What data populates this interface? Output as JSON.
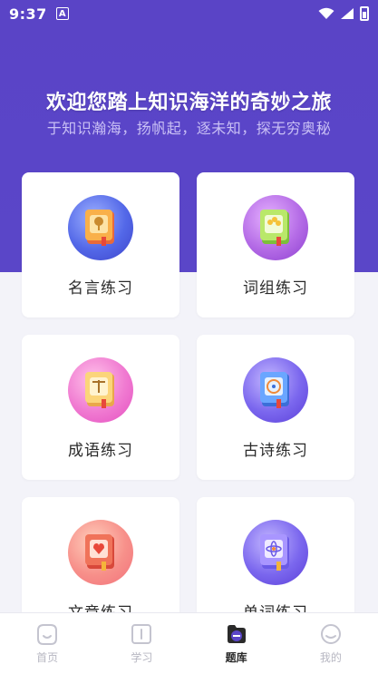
{
  "status_bar": {
    "time": "9:37",
    "notification_badge": "A"
  },
  "header": {
    "title": "欢迎您踏上知识海洋的奇妙之旅",
    "subtitle": "于知识瀚海，扬帆起，逐未知，探无穷奥秘"
  },
  "cards": [
    {
      "label": "名言练习",
      "icon": "tree-book-icon"
    },
    {
      "label": "词组练习",
      "icon": "flower-book-icon"
    },
    {
      "label": "成语练习",
      "icon": "scale-book-icon"
    },
    {
      "label": "古诗练习",
      "icon": "compass-book-icon"
    },
    {
      "label": "文章练习",
      "icon": "heart-book-icon"
    },
    {
      "label": "单词练习",
      "icon": "atom-book-icon"
    }
  ],
  "tabs": [
    {
      "label": "首页",
      "icon": "home-icon",
      "active": false
    },
    {
      "label": "学习",
      "icon": "book-icon",
      "active": false
    },
    {
      "label": "题库",
      "icon": "question-bank-icon",
      "active": true
    },
    {
      "label": "我的",
      "icon": "profile-icon",
      "active": false
    }
  ],
  "colors": {
    "primary": "#5a45c8",
    "subtitle": "#c9c0f5",
    "tab_inactive": "#b7b7c2"
  }
}
